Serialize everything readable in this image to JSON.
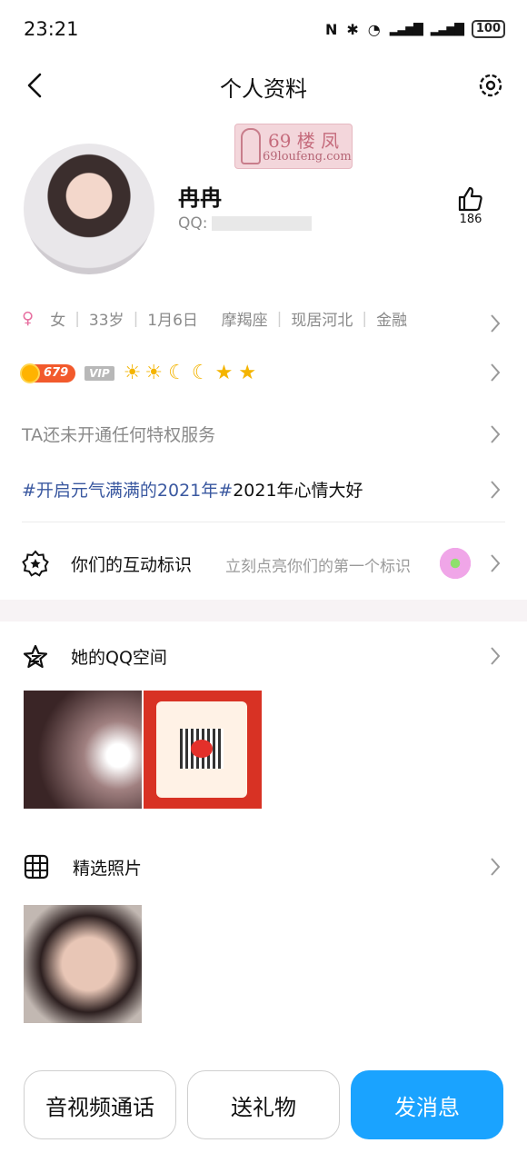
{
  "status_bar": {
    "time": "23:21",
    "battery": "100"
  },
  "header": {
    "title": "个人资料",
    "back_icon": "back-arrow-icon",
    "settings_icon": "gear-icon"
  },
  "watermark": {
    "line1": "69 楼 凤",
    "line2": "69loufeng.com"
  },
  "profile": {
    "nickname": "冉冉",
    "qq_label": "QQ:",
    "likes": "186"
  },
  "info": {
    "gender_symbol": "♀",
    "gender": "女",
    "age": "33岁",
    "birthday": "1月6日",
    "zodiac": "摩羯座",
    "residence": "现居河北",
    "industry": "金融"
  },
  "badges": {
    "coin_value": "679",
    "vip": "VIP",
    "level_icons": [
      "☀",
      "☀",
      "☾",
      "☾",
      "★",
      "★"
    ]
  },
  "privilege_text": "TA还未开通任何特权服务",
  "mood": {
    "tag": "#开启元气满满的2021年#",
    "text": "2021年心情大好"
  },
  "interaction": {
    "label": "你们的互动标识",
    "hint": "立刻点亮你们的第一个标识"
  },
  "qzone": {
    "label": "她的QQ空间"
  },
  "photos": {
    "label": "精选照片"
  },
  "actions": {
    "call": "音视频通话",
    "gift": "送礼物",
    "message": "发消息"
  },
  "colors": {
    "accent": "#1aa3ff",
    "gender": "#e76fa0",
    "tag": "#3a58a0"
  }
}
